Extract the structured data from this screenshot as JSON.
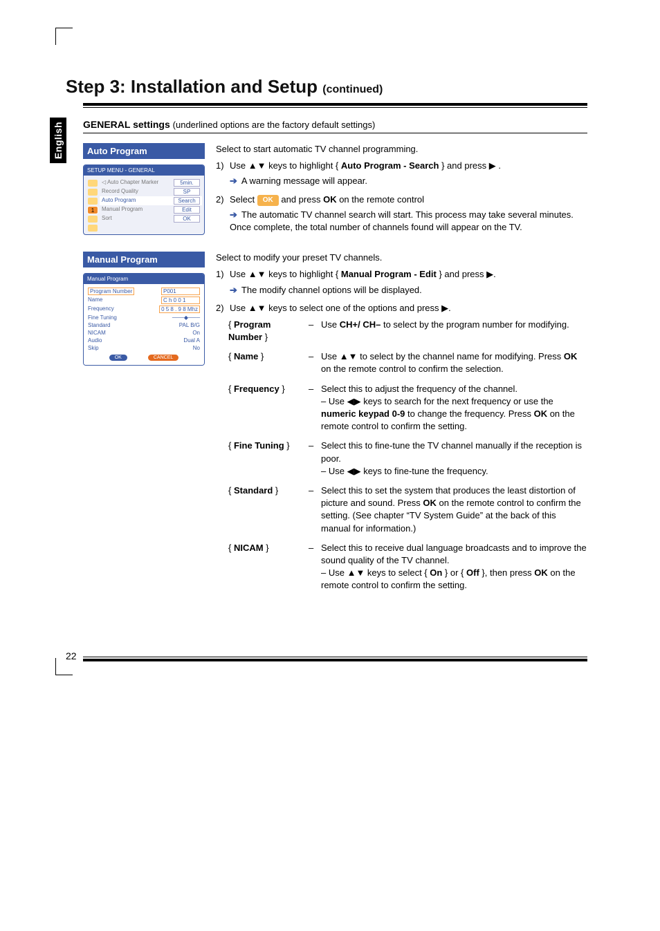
{
  "language_tab": "English",
  "page_title_main": "Step 3: Installation and Setup ",
  "page_title_cont": "(continued)",
  "section_header_bold": "GENERAL settings ",
  "section_header_note": "(underlined options are the factory default settings)",
  "page_number": "22",
  "auto_program": {
    "title": "Auto Program",
    "intro": "Select to start automatic TV channel programming.",
    "step1_num": "1)",
    "step1_a": "Use ",
    "step1_keys": "▲▼",
    "step1_b": " keys to highlight  { ",
    "step1_bold": "Auto Program - Search",
    "step1_c": " } and press ",
    "step1_tri": "▶",
    "step1_end": " .",
    "step1_result": "A warning message will appear.",
    "step2_num": "2)",
    "step2_a": "Select ",
    "step2_ok_badge": "OK",
    "step2_b": " and press ",
    "step2_ok_bold": "OK",
    "step2_c": " on the remote control",
    "step2_result": "The automatic TV channel search will start. This process may take several minutes. Once complete, the total number of channels found will appear on the TV.",
    "osd": {
      "head": "SETUP MENU - GENERAL",
      "rows": [
        {
          "label": "Auto Chapter Marker",
          "value": "5min."
        },
        {
          "label": "Record Quality",
          "value": "SP"
        },
        {
          "label": "Auto Program",
          "value": "Search"
        },
        {
          "label": "Manual Program",
          "value": "Edit"
        },
        {
          "label": "Sort",
          "value": "OK"
        }
      ]
    }
  },
  "manual_program": {
    "title": "Manual Program",
    "intro": "Select to modify your preset TV channels.",
    "step1_num": "1)",
    "step1_a": "Use ",
    "step1_keys": "▲▼",
    "step1_b": " keys to highlight  { ",
    "step1_bold": "Manual Program - Edit",
    "step1_c": " } and press ",
    "step1_tri": "▶",
    "step1_end": ".",
    "step1_result": "The modify channel options will be displayed.",
    "step2_num": "2)",
    "step2_a": "Use ",
    "step2_keys": "▲▼",
    "step2_b": " keys to select one of the options and press ",
    "step2_tri": "▶",
    "step2_end": ".",
    "osd": {
      "head": "Manual Program",
      "rows": [
        {
          "label": "Program Number",
          "value": "P001"
        },
        {
          "label": "Name",
          "value": "C h 0 0 1"
        },
        {
          "label": "Frequency",
          "value": "0 5 8 . 9 8 Mhz"
        },
        {
          "label": "Fine Tuning",
          "value": ""
        },
        {
          "label": "Standard",
          "value": "PAL B/G"
        },
        {
          "label": "NICAM",
          "value": "On"
        },
        {
          "label": "Audio",
          "value": "Dual A"
        },
        {
          "label": "Skip",
          "value": "No"
        }
      ],
      "ok": "OK",
      "cancel": "CANCEL"
    },
    "options": [
      {
        "key_open": "{ ",
        "key_bold": "Program Number",
        "key_close": " }",
        "sep": "–",
        "desc_a": "Use ",
        "desc_bold1": "CH+/ CH–",
        "desc_b": " to select by the program number for modifying."
      },
      {
        "key_open": "{ ",
        "key_bold": "Name",
        "key_close": " }",
        "sep": "–",
        "desc_a": "Use ",
        "desc_keys": "▲▼",
        "desc_b": " to select by the channel name for modifying. Press ",
        "desc_bold1": "OK",
        "desc_c": " on the remote control to confirm the selection."
      },
      {
        "key_open": "{ ",
        "key_bold": "Frequency",
        "key_close": " }",
        "sep": "–",
        "desc_a": "Select this to adjust the frequency of the channel.",
        "line2_pre": "– Use ",
        "line2_keys": "◀▶",
        "line2_a": " keys to search for the next frequency or use the ",
        "line2_bold": "numeric keypad 0-9",
        "line2_b": " to change the frequency. Press ",
        "line2_bold2": "OK",
        "line2_c": " on the remote control to confirm the setting."
      },
      {
        "key_open": "{ ",
        "key_bold": "Fine Tuning",
        "key_close": " }",
        "sep": "–",
        "desc_a": "Select this to fine-tune the TV channel manually if the reception is poor.",
        "line2_pre": "– Use ",
        "line2_keys": "◀▶",
        "line2_a": " keys to fine-tune the frequency."
      },
      {
        "key_open": "{ ",
        "key_bold": "Standard",
        "key_close": " }",
        "sep": "–",
        "desc_a": "Select this to set the system that produces the least distortion of picture and sound. Press ",
        "desc_bold1": "OK",
        "desc_b": " on the remote control to confirm the setting. (See chapter “TV System Guide” at the back of this manual for information.)"
      },
      {
        "key_open": "{ ",
        "key_bold": "NICAM",
        "key_close": " }",
        "sep": "–",
        "desc_a": "Select this to receive dual language broadcasts and to improve the sound quality of the TV channel.",
        "line2_pre": "– Use ",
        "line2_keys": "▲▼",
        "line2_a": " keys to select { ",
        "line2_bold": "On",
        "line2_b": " } or { ",
        "line2_bold2": "Off",
        "line2_c": " }, then press ",
        "line2_bold3": "OK",
        "line2_d": " on the remote control to confirm the setting."
      }
    ]
  }
}
